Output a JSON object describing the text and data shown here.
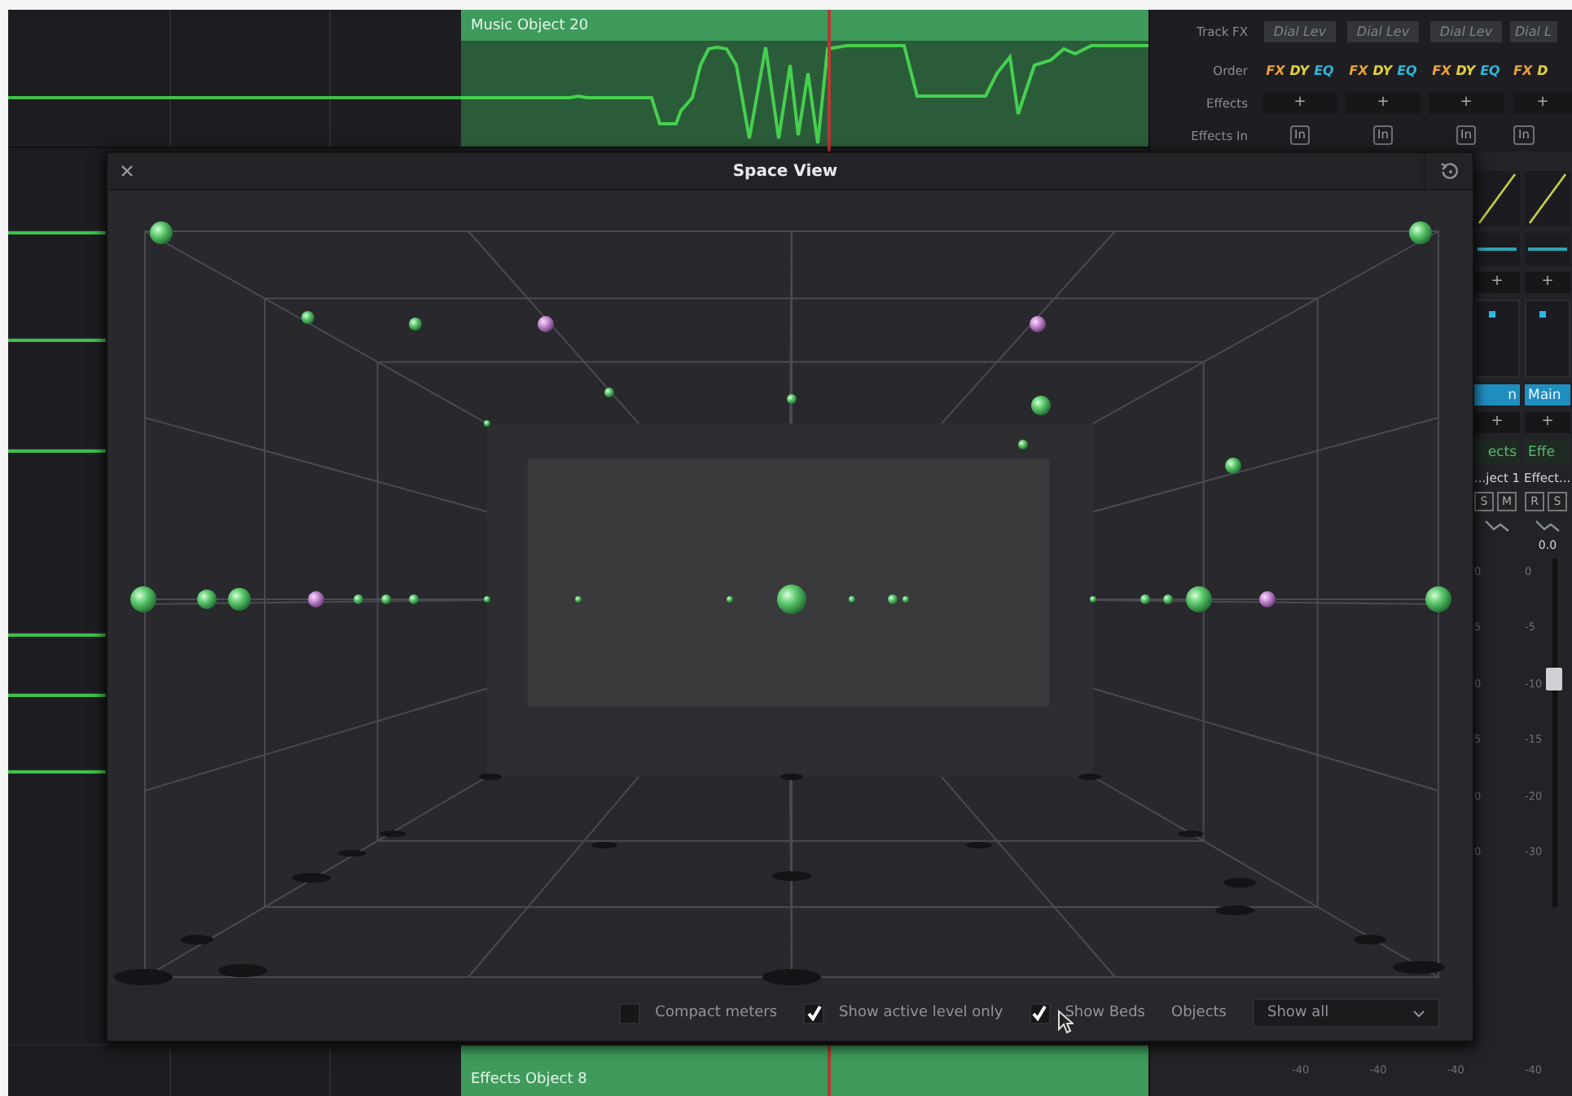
{
  "timeline": {
    "top_clip": {
      "title": "Music Object 20"
    },
    "bottom_clip": {
      "title": "Effects Object 8"
    }
  },
  "mixer": {
    "row_labels": [
      "Track FX",
      "Order",
      "Effects",
      "Effects In"
    ],
    "channels": [
      {
        "track_fx": "Dial Lev",
        "order": [
          {
            "label": "FX",
            "color": "#e8a23a"
          },
          {
            "label": "DY",
            "color": "#e3d13a"
          },
          {
            "label": "EQ",
            "color": "#2fb6d8"
          }
        ],
        "effects": "+",
        "effects_in": "In"
      },
      {
        "track_fx": "Dial Lev",
        "order": [
          {
            "label": "FX",
            "color": "#e8a23a"
          },
          {
            "label": "DY",
            "color": "#e3d13a"
          },
          {
            "label": "EQ",
            "color": "#2fb6d8"
          }
        ],
        "effects": "+",
        "effects_in": "In"
      },
      {
        "track_fx": "Dial Lev",
        "order": [
          {
            "label": "FX",
            "color": "#e8a23a"
          },
          {
            "label": "DY",
            "color": "#e3d13a"
          },
          {
            "label": "EQ",
            "color": "#2fb6d8"
          }
        ],
        "effects": "+",
        "effects_in": "In"
      },
      {
        "track_fx": "Dial L",
        "order": [
          {
            "label": "FX",
            "color": "#e8a23a"
          },
          {
            "label": "D",
            "color": "#e3d13a"
          }
        ],
        "effects": "+",
        "effects_in": "In"
      }
    ],
    "strips": [
      {
        "bus": "n",
        "add": "+",
        "send": "ects",
        "buttons": [
          "S",
          "M"
        ],
        "scale": [
          "0",
          "5",
          "0",
          "5",
          "0",
          "0"
        ]
      },
      {
        "bus": "Main",
        "add": "+",
        "send": "Effe",
        "buttons": [
          "R",
          "S"
        ],
        "reading": "0.0",
        "level": 0.62,
        "scale": [
          "0",
          "-5",
          "-10",
          "-15",
          "-20",
          "-30"
        ]
      }
    ],
    "strip_name": "...ject 1 Effect...",
    "floor_scale": [
      "-40",
      "-40",
      "-40",
      "-40"
    ]
  },
  "space_view": {
    "title": "Space View",
    "options": [
      {
        "kind": "checkbox",
        "label": "Compact meters",
        "checked": false
      },
      {
        "kind": "checkbox",
        "label": "Show active level only",
        "checked": true
      },
      {
        "kind": "checkbox",
        "label": "Show Beds",
        "checked": true
      }
    ],
    "objects": {
      "label": "Objects",
      "value": "Show all"
    }
  }
}
